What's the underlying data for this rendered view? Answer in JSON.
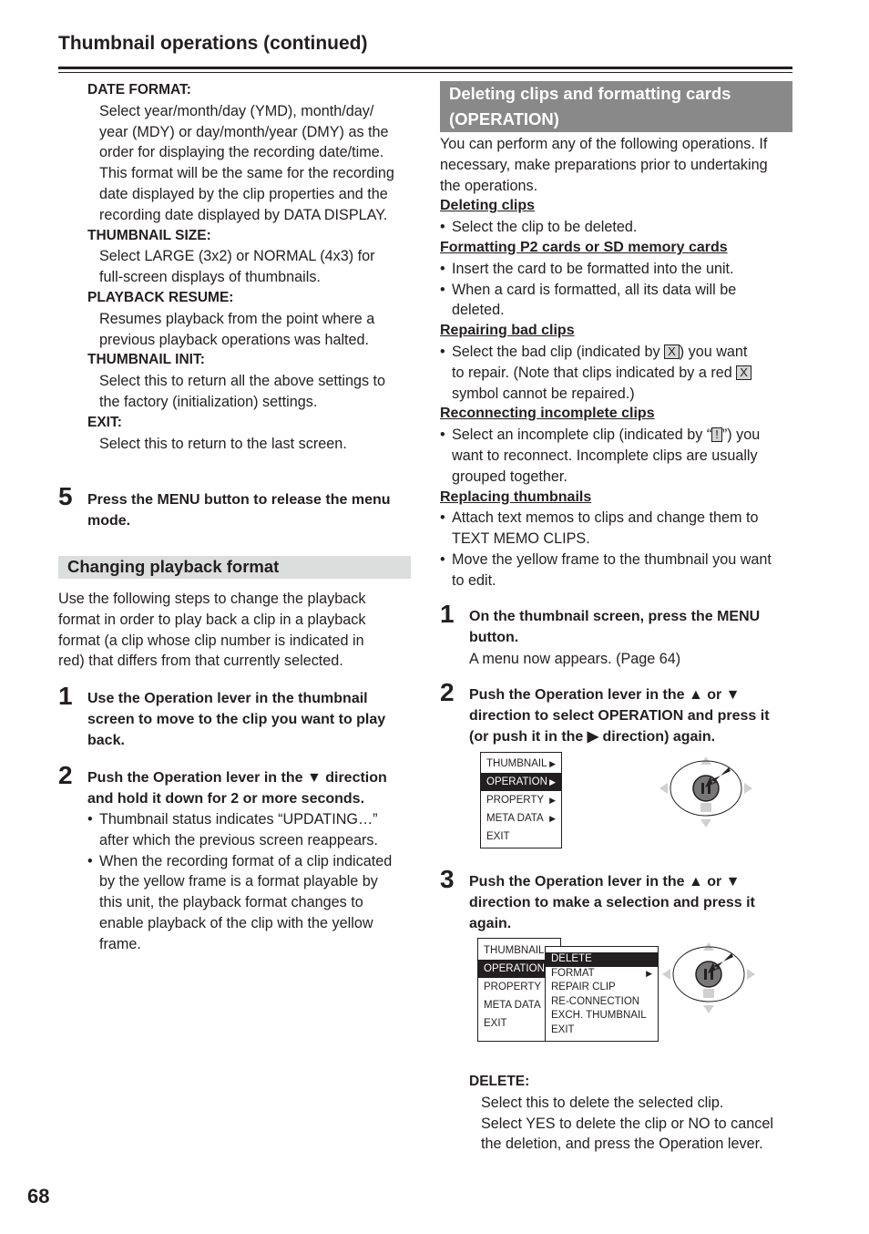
{
  "header": {
    "title": "Thumbnail operations (continued)"
  },
  "page_number": "68",
  "left": {
    "settings": [
      {
        "label": "DATE FORMAT:",
        "lines": [
          "Select year/month/day (YMD), month/day/",
          "year (MDY) or day/month/year (DMY) as the",
          "order for displaying the recording date/time.",
          "This format will be the same for the recording",
          "date displayed by the clip properties and the",
          "recording date displayed by DATA DISPLAY."
        ]
      },
      {
        "label": "THUMBNAIL SIZE:",
        "lines": [
          "Select LARGE (3x2) or NORMAL (4x3) for",
          "full-screen displays of thumbnails."
        ]
      },
      {
        "label": "PLAYBACK RESUME:",
        "lines": [
          "Resumes playback from the point where a",
          "previous playback operations was halted."
        ]
      },
      {
        "label": "THUMBNAIL INIT:",
        "lines": [
          "Select this to return all the above settings to",
          "the factory (initialization) settings."
        ]
      },
      {
        "label": "EXIT:",
        "lines": [
          "Select this to return to the last screen."
        ]
      }
    ],
    "step5": {
      "num": "5",
      "text": [
        "Press the MENU button to release the menu",
        "mode."
      ]
    },
    "section_title": "Changing playback format",
    "intro": [
      "Use the following steps to change the playback",
      "format in order to play back a clip in a playback",
      "format (a clip whose clip number is indicated in",
      "red) that differs from that currently selected."
    ],
    "step1": {
      "num": "1",
      "text": [
        "Use the Operation lever in the thumbnail",
        "screen to move to the clip you want to play",
        "back."
      ]
    },
    "step2": {
      "num": "2",
      "text": [
        "Push the Operation lever in the ▼ direction",
        "and hold it down for 2 or more seconds."
      ],
      "bullets": [
        [
          "Thumbnail status indicates “UPDATING…”",
          "after which the previous screen reappears."
        ],
        [
          "When the recording format of a clip indicated",
          "by the yellow frame is a format playable by",
          "this unit, the playback format changes to",
          "enable playback of the clip with the yellow",
          "frame."
        ]
      ]
    }
  },
  "right": {
    "section_title": [
      "Deleting clips and formatting cards",
      "(OPERATION)"
    ],
    "intro": [
      "You can perform any of the following operations. If",
      "necessary, make preparations prior to undertaking",
      "the operations."
    ],
    "deleting": {
      "heading": "Deleting clips",
      "bullets": [
        [
          "Select the clip to be deleted."
        ]
      ]
    },
    "formatting": {
      "heading": "Formatting P2 cards or SD memory cards",
      "bullets": [
        [
          "Insert the card to be formatted into the unit."
        ],
        [
          "When a card is formatted, all its data will be",
          "deleted."
        ]
      ]
    },
    "repairing": {
      "heading": "Repairing bad clips",
      "l1a": "Select the bad clip (indicated by ",
      "sym": "X",
      "l1b": ") you want",
      "l2": "to repair. (Note that clips indicated by a red ",
      "l3": "symbol cannot be repaired.)"
    },
    "reconnecting": {
      "heading": "Reconnecting incomplete clips",
      "l1a": "Select an incomplete clip (indicated by “",
      "sym": "!",
      "l1b": "”) you",
      "l2": "want to reconnect. Incomplete clips are usually",
      "l3": "grouped together."
    },
    "replacing": {
      "heading": "Replacing thumbnails",
      "bullets": [
        [
          "Attach text memos to clips and change them to",
          "TEXT MEMO CLIPS."
        ],
        [
          "Move the yellow frame to the thumbnail you want",
          "to edit."
        ]
      ]
    },
    "step1": {
      "num": "1",
      "text": [
        "On the thumbnail screen, press the MENU",
        "button."
      ],
      "note": "A menu now appears. (Page 64)"
    },
    "step2": {
      "num": "2",
      "text": [
        "Push the Operation lever in the ▲ or ▼",
        "direction to select OPERATION and press it",
        "(or push it in the ▶ direction) again."
      ]
    },
    "step3": {
      "num": "3",
      "text": [
        "Push the Operation lever in the ▲ or ▼",
        "direction to make a selection and press it",
        "again."
      ]
    },
    "menu1": [
      {
        "label": "THUMBNAIL",
        "arrow": "▶"
      },
      {
        "label": "OPERATION",
        "arrow": "▶",
        "selected": true
      },
      {
        "label": "PROPERTY",
        "arrow": "▶"
      },
      {
        "label": "META DATA",
        "arrow": "▶"
      },
      {
        "label": "EXIT",
        "arrow": ""
      }
    ],
    "menu2": [
      {
        "label": "THUMBNAIL"
      },
      {
        "label": "OPERATION",
        "selected": true
      },
      {
        "label": "PROPERTY"
      },
      {
        "label": "META DATA"
      },
      {
        "label": "EXIT"
      }
    ],
    "submenu": [
      {
        "label": "DELETE",
        "arrow": "",
        "selected": true
      },
      {
        "label": "FORMAT",
        "arrow": "▶"
      },
      {
        "label": "REPAIR CLIP",
        "arrow": ""
      },
      {
        "label": "RE-CONNECTION",
        "arrow": ""
      },
      {
        "label": "EXCH. THUMBNAIL",
        "arrow": ""
      },
      {
        "label": "EXIT",
        "arrow": ""
      }
    ],
    "delete_desc": {
      "label": "DELETE:",
      "lines": [
        "Select this to delete the selected clip.",
        "Select YES to delete the clip or NO to cancel",
        "the deletion, and press the Operation lever."
      ]
    }
  }
}
